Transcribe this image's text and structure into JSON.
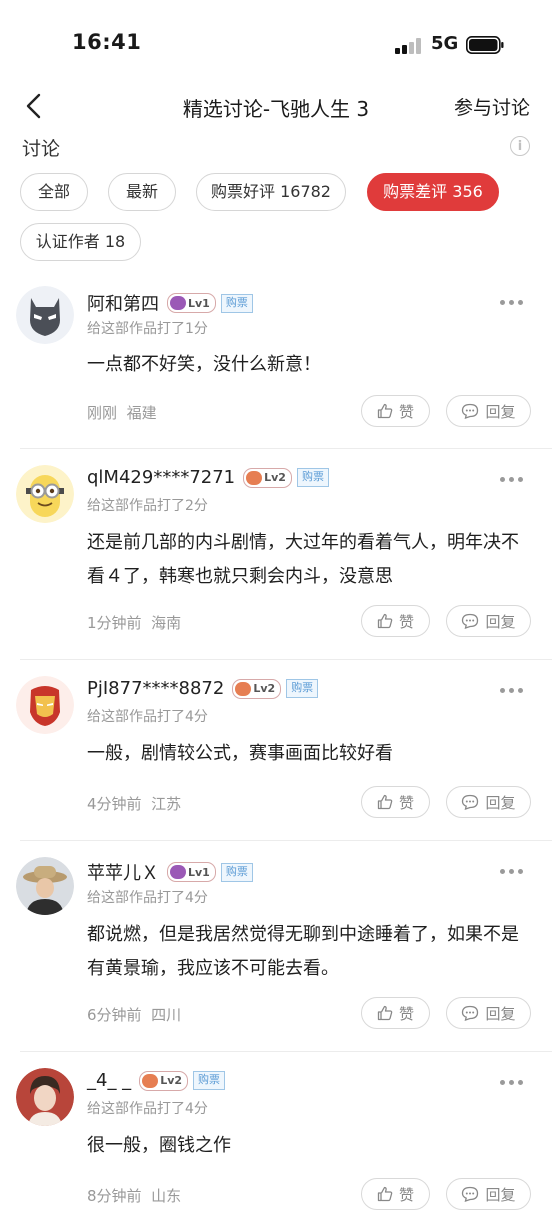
{
  "status": {
    "time": "16:41",
    "network": "5G"
  },
  "nav": {
    "title": "精选讨论-飞驰人生 3",
    "action": "参与讨论"
  },
  "section": {
    "title": "讨论",
    "info_icon": "info-icon"
  },
  "filters": [
    {
      "label": "全部",
      "active": false
    },
    {
      "label": "最新",
      "active": false
    },
    {
      "label": "购票好评 16782",
      "active": false
    },
    {
      "label": "购票差评 356",
      "active": true
    },
    {
      "label": "认证作者 18",
      "active": false
    }
  ],
  "actions": {
    "like": "赞",
    "reply": "回复"
  },
  "colors": {
    "accent": "#e03b3b",
    "tag": "#5b9bd5"
  },
  "comments": [
    {
      "user": "阿和第四",
      "level": "Lv1",
      "tag": "购票",
      "rating": "给这部作品打了1分",
      "text": "一点都不好笑，没什么新意！",
      "time": "刚刚",
      "location": "福建",
      "avatar": "bat-mask-avatar"
    },
    {
      "user": "qlM429****7271",
      "level": "Lv2",
      "tag": "购票",
      "rating": "给这部作品打了2分",
      "text": "还是前几部的内斗剧情，大过年的看着气人，明年决不看４了，韩寒也就只剩会内斗，没意思",
      "time": "1分钟前",
      "location": "海南",
      "avatar": "minion-avatar"
    },
    {
      "user": "PjI877****8872",
      "level": "Lv2",
      "tag": "购票",
      "rating": "给这部作品打了4分",
      "text": "一般，剧情较公式，赛事画面比较好看",
      "time": "4分钟前",
      "location": "江苏",
      "avatar": "ironman-avatar"
    },
    {
      "user": "苹苹儿Ｘ",
      "level": "Lv1",
      "tag": "购票",
      "rating": "给这部作品打了4分",
      "text": "都说燃，但是我居然觉得无聊到中途睡着了，如果不是有黄景瑜，我应该不可能去看。",
      "time": "6分钟前",
      "location": "四川",
      "avatar": "photo-avatar"
    },
    {
      "user": "_4_ _",
      "level": "Lv2",
      "tag": "购票",
      "rating": "给这部作品打了4分",
      "text": "很一般，圈钱之作",
      "time": "8分钟前",
      "location": "山东",
      "avatar": "portrait-avatar"
    }
  ]
}
